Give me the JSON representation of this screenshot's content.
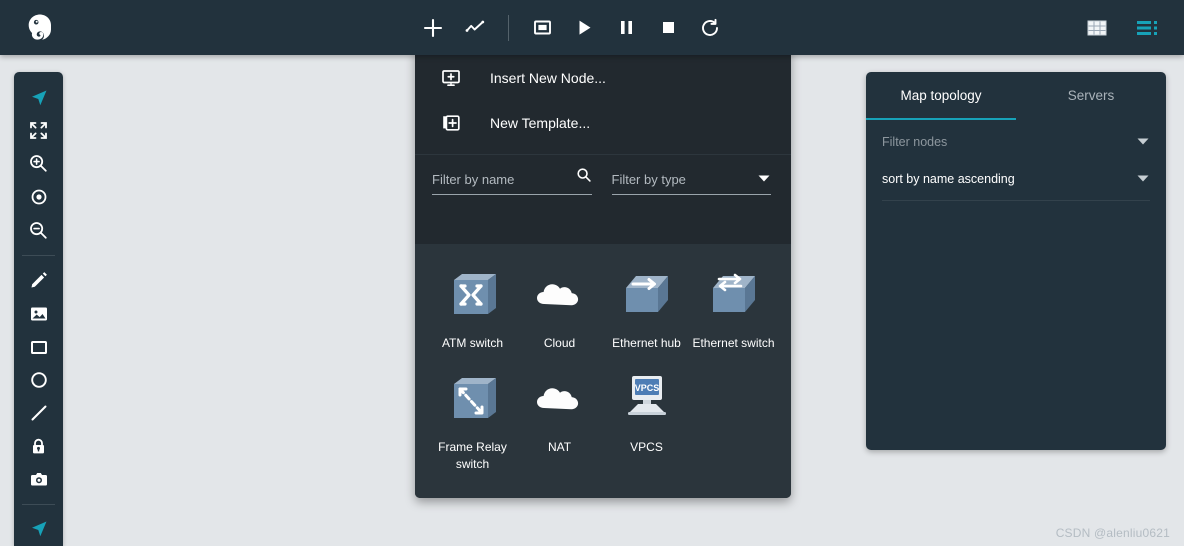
{
  "app": {
    "logo_icon": "gns3-chameleon-logo"
  },
  "toolbar": {
    "items": [
      {
        "name": "add-node-button",
        "icon": "plus-icon",
        "label": "Add a node"
      },
      {
        "name": "add-link-button",
        "icon": "link-chart-icon",
        "label": "Add a link"
      },
      {
        "name": "toolbar-divider",
        "icon": "divider",
        "label": ""
      },
      {
        "name": "stop-all-outline-button",
        "icon": "square-outline-icon",
        "label": "Console to all nodes"
      },
      {
        "name": "start-all-button",
        "icon": "play-icon",
        "label": "Start all nodes"
      },
      {
        "name": "pause-all-button",
        "icon": "pause-icon",
        "label": "Suspend all nodes"
      },
      {
        "name": "stop-all-button",
        "icon": "stop-square-icon",
        "label": "Stop all nodes"
      },
      {
        "name": "reload-all-button",
        "icon": "reload-icon",
        "label": "Reload all nodes"
      }
    ],
    "right_items": [
      {
        "name": "grid-view-button",
        "icon": "grid-icon",
        "label": "Grid"
      },
      {
        "name": "menu-list-button",
        "icon": "list-menu-icon",
        "label": "Menu"
      }
    ]
  },
  "sidebar": {
    "items": [
      {
        "name": "sidebar-item-move",
        "icon": "navigation-arrow-icon",
        "label": "Move",
        "active": true
      },
      {
        "name": "sidebar-item-fullscreen",
        "icon": "fullscreen-icon",
        "label": "Fit to window",
        "active": false
      },
      {
        "name": "sidebar-item-zoom-in",
        "icon": "zoom-in-icon",
        "label": "Zoom in",
        "active": false
      },
      {
        "name": "sidebar-item-reset-zoom",
        "icon": "target-dot-icon",
        "label": "Reset zoom",
        "active": false
      },
      {
        "name": "sidebar-item-zoom-out",
        "icon": "zoom-out-icon",
        "label": "Zoom out",
        "active": false
      },
      {
        "name": "sidebar-divider-1",
        "icon": "divider",
        "label": "",
        "active": false
      },
      {
        "name": "sidebar-item-draw-text",
        "icon": "pencil-icon",
        "label": "Add a text",
        "active": false
      },
      {
        "name": "sidebar-item-add-image",
        "icon": "image-icon",
        "label": "Add an image",
        "active": false
      },
      {
        "name": "sidebar-item-rectangle",
        "icon": "rectangle-icon",
        "label": "Draw a rectangle",
        "active": false
      },
      {
        "name": "sidebar-item-ellipse",
        "icon": "circle-icon",
        "label": "Draw an ellipse",
        "active": false
      },
      {
        "name": "sidebar-item-line",
        "icon": "line-icon",
        "label": "Draw a line",
        "active": false
      },
      {
        "name": "sidebar-item-lock",
        "icon": "lock-icon",
        "label": "Lock items",
        "active": false
      },
      {
        "name": "sidebar-item-screenshot",
        "icon": "camera-icon",
        "label": "Take a screenshot",
        "active": false
      },
      {
        "name": "sidebar-divider-2",
        "icon": "divider",
        "label": "",
        "active": false
      },
      {
        "name": "sidebar-item-move-bottom",
        "icon": "navigation-arrow-icon",
        "label": "Move",
        "active": true
      }
    ]
  },
  "menu": {
    "actions": [
      {
        "name": "insert-new-node-item",
        "icon": "monitor-plus-icon",
        "label": "Insert New Node..."
      },
      {
        "name": "new-template-item",
        "icon": "copy-plus-icon",
        "label": "New Template..."
      }
    ],
    "filter_name": {
      "placeholder": "Filter by name",
      "value": "",
      "icon": "search-icon"
    },
    "filter_type": {
      "placeholder": "Filter by type",
      "value": "",
      "icon": "chevron-down-icon"
    },
    "devices": [
      {
        "name": "device-atm-switch",
        "icon": "atm-switch-icon",
        "label": "ATM switch"
      },
      {
        "name": "device-cloud",
        "icon": "cloud-icon",
        "label": "Cloud"
      },
      {
        "name": "device-ethernet-hub",
        "icon": "ethernet-hub-icon",
        "label": "Ethernet hub"
      },
      {
        "name": "device-ethernet-switch",
        "icon": "ethernet-switch-icon",
        "label": "Ethernet switch"
      },
      {
        "name": "device-frame-relay-switch",
        "icon": "frame-relay-switch-icon",
        "label": "Frame Relay switch"
      },
      {
        "name": "device-nat",
        "icon": "nat-cloud-icon",
        "label": "NAT"
      },
      {
        "name": "device-vpcs",
        "icon": "vpcs-icon",
        "label": "VPCS"
      }
    ]
  },
  "right_panel": {
    "tabs": [
      {
        "name": "tab-map-topology",
        "label": "Map topology",
        "active": true
      },
      {
        "name": "tab-servers",
        "label": "Servers",
        "active": false
      }
    ],
    "filter_nodes": {
      "placeholder": "Filter nodes",
      "value": ""
    },
    "sort_select": {
      "value": "sort by name ascending"
    }
  },
  "watermark": {
    "text": "CSDN @alenliu0621"
  },
  "colors": {
    "header_bg": "#22323d",
    "menu_bg": "#22292f",
    "device_area_bg": "#2b353c",
    "canvas_bg": "#e3e6e9",
    "accent": "#17a2b8",
    "device_blue": "#6f8fae"
  }
}
